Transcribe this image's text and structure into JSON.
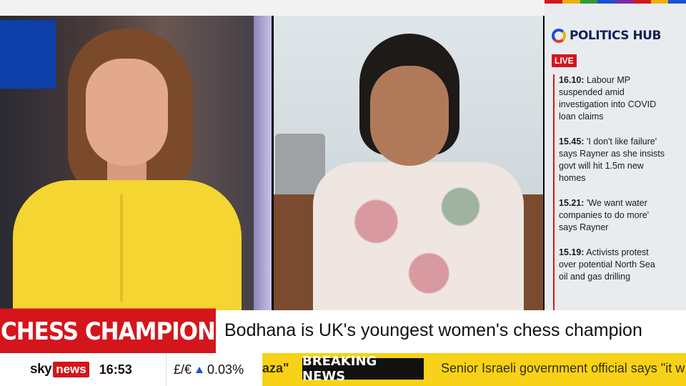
{
  "colors": {
    "sky_red": "#d4151c",
    "ticker_yellow": "#f7d218",
    "hub_blue": "#1d4fd1",
    "presenter_yellow": "#f5d531",
    "stripes": [
      "#d6151d",
      "#e8b10c",
      "#2e9a3a",
      "#1d4fd1",
      "#7b2aa8",
      "#d6151d",
      "#e8b10c",
      "#1d4fd1"
    ]
  },
  "politics_hub": {
    "icon": "politics-hub-logo-icon",
    "title": "POLITICS HUB",
    "live_label": "LIVE",
    "items": [
      {
        "time": "16.10:",
        "text": "Labour MP suspended amid investigation into COVID loan claims"
      },
      {
        "time": "15.45:",
        "text": "'I don't like failure' says Rayner as she insists govt will hit 1.5m new homes"
      },
      {
        "time": "15.21:",
        "text": "'We want water companies to do more' says Rayner"
      },
      {
        "time": "15.19:",
        "text": "Activists protest over potential North Sea oil and gas drilling"
      }
    ]
  },
  "lower_third": {
    "label": "CHESS CHAMPION",
    "headline": "Bodhana is UK's youngest women's chess champion"
  },
  "ticker": {
    "brand_sky": "sky",
    "brand_news": "news",
    "clock": "16:53",
    "currency_pair": "£/€",
    "currency_direction_icon": "up-arrow-icon",
    "currency_change": "0.03%",
    "previous_fragment": "aza\"",
    "breaking_label": "BREAKING NEWS",
    "scroll_text": "Senior Israeli government official says \"it w"
  }
}
